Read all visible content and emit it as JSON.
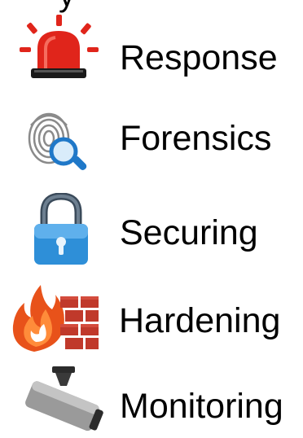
{
  "items": [
    {
      "label": "Response",
      "icon": "siren-icon"
    },
    {
      "label": "Forensics",
      "icon": "fingerprint-magnifier-icon"
    },
    {
      "label": "Securing",
      "icon": "padlock-icon"
    },
    {
      "label": "Hardening",
      "icon": "firewall-icon"
    },
    {
      "label": "Monitoring",
      "icon": "security-camera-icon"
    }
  ],
  "colors": {
    "siren_red": "#e0251b",
    "padlock_blue": "#2e8fd8",
    "flame_orange": "#e8521a",
    "brick_red": "#c0392b",
    "camera_gray": "#8a8a8a",
    "magnifier_blue": "#1f78c8"
  }
}
